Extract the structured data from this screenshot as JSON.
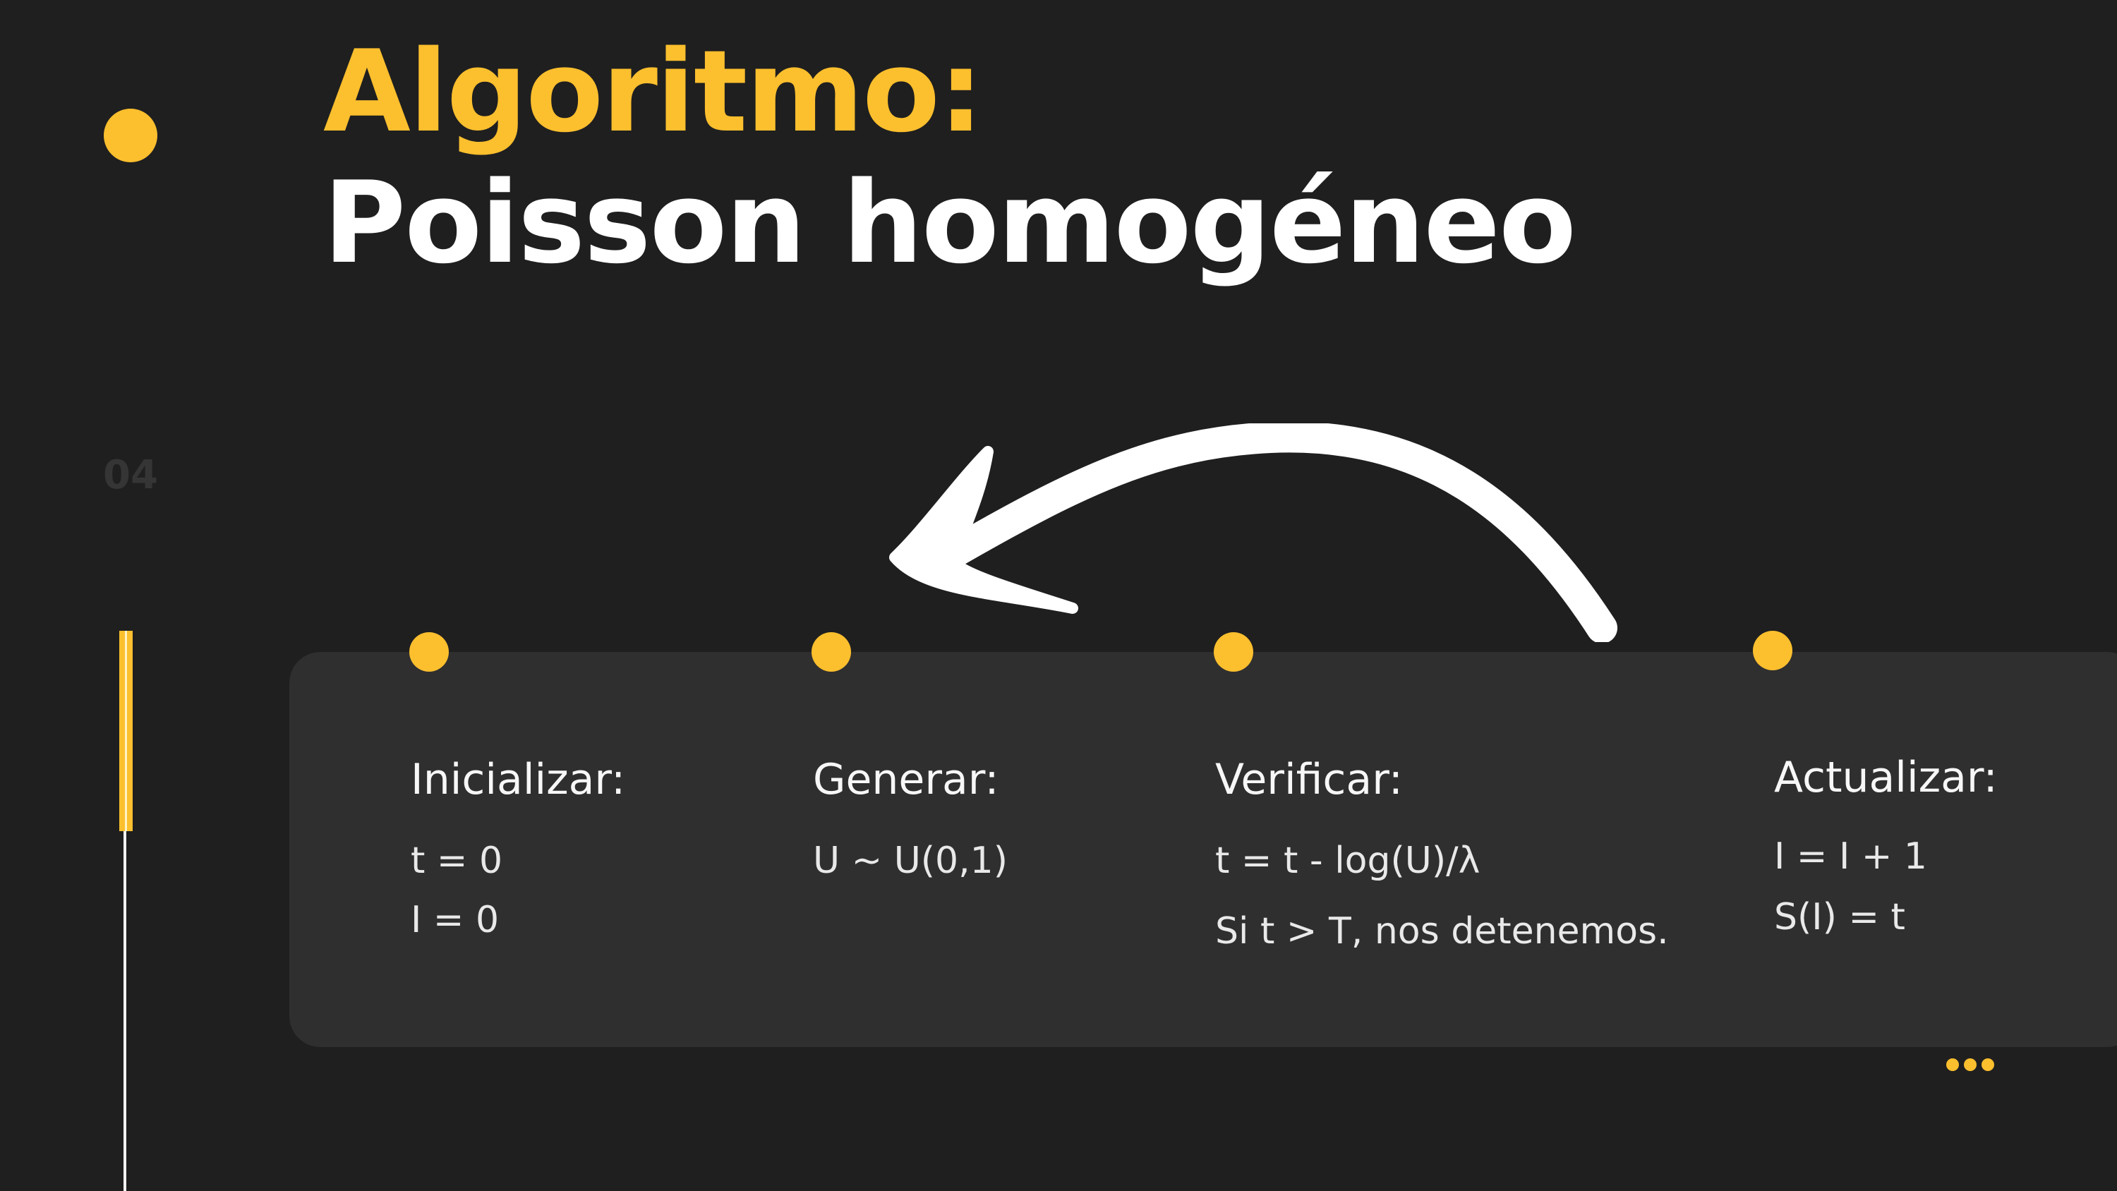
{
  "slide": {
    "title_line1": "Algoritmo:",
    "title_line2": "Poisson homogéneo",
    "number": "04",
    "accent_color": "#fcbf2e"
  },
  "steps": [
    {
      "title": "Inicializar:",
      "lines": [
        "t = 0",
        "I = 0"
      ]
    },
    {
      "title": "Generar:",
      "lines": [
        "U ~ U(0,1)"
      ]
    },
    {
      "title": "Verificar:",
      "lines": [
        "t = t - log(U)/λ",
        "Si t > T, nos detenemos."
      ]
    },
    {
      "title": "Actualizar:",
      "lines": [
        "I = I + 1",
        "S(I) = t"
      ]
    }
  ],
  "decorations": {
    "arrow_icon": "curved-arrow-left-icon",
    "more_icon": "ellipsis-icon"
  }
}
